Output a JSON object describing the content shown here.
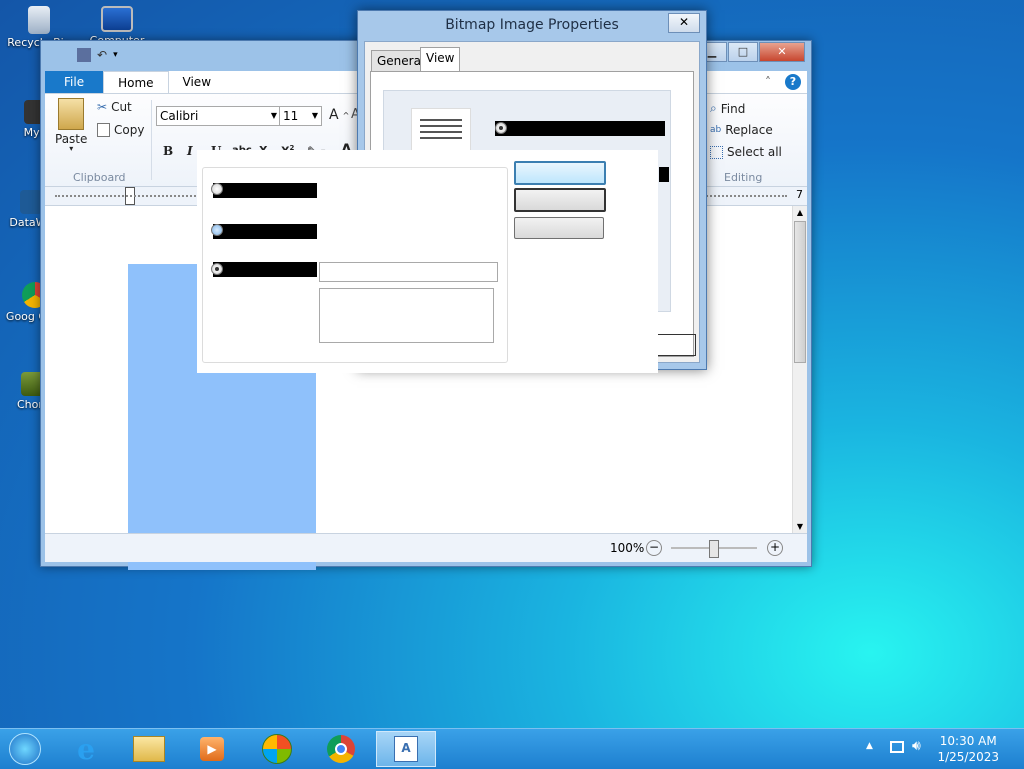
{
  "desktop": {
    "icons": [
      {
        "label": "Recycle Bin"
      },
      {
        "label": "Computer"
      },
      {
        "label": "MyP"
      },
      {
        "label": "DataWa"
      },
      {
        "label": "Goog Chro"
      },
      {
        "label": "Chom"
      }
    ]
  },
  "wordpad": {
    "tabs": [
      "File",
      "Home",
      "View"
    ],
    "clipboard": {
      "paste": "Paste",
      "cut": "Cut",
      "copy": "Copy",
      "group": "Clipboard"
    },
    "font": {
      "name": "Calibri",
      "size": "11"
    },
    "editing": {
      "find": "Find",
      "replace": "Replace",
      "select_all": "Select all",
      "group": "Editing"
    },
    "ruler_end": "7",
    "zoom": "100%"
  },
  "dialog": {
    "title": "Bitmap Image Properties",
    "close": "✕",
    "tabs": [
      "General",
      "View"
    ]
  },
  "taskbar": {
    "time": "10:30 AM",
    "date": "1/25/2023"
  }
}
